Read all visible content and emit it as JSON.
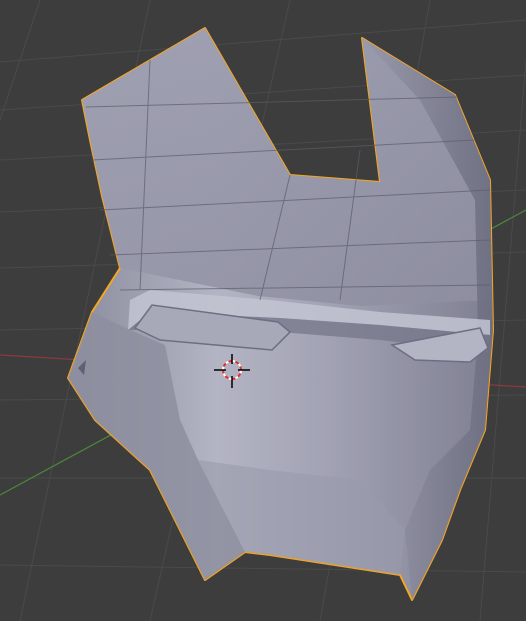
{
  "viewport": {
    "background": "#3d3d3d",
    "grid_color": "#4a4a4a",
    "x_axis_color": "#8b3a3a",
    "y_axis_color": "#4d8b3a",
    "selection_outline_color": "#f5a623",
    "mesh_base_color": "#9d9eb0"
  },
  "object": {
    "icon": "iron-man-helmet-mesh",
    "state": "selected"
  },
  "cursor": {
    "icon": "3d-cursor-icon"
  }
}
